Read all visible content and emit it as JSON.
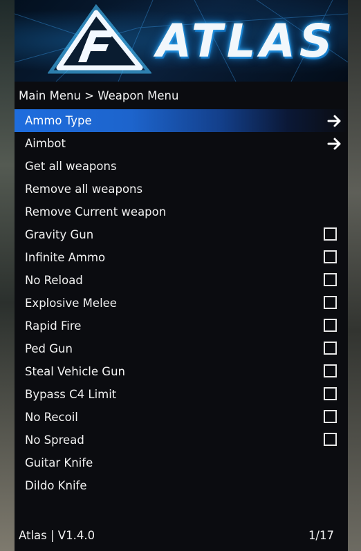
{
  "banner": {
    "logo_icon": "atlas-logo-icon",
    "brand": "ATLAS"
  },
  "breadcrumb": "Main Menu > Weapon Menu",
  "menu": {
    "items": [
      {
        "label": "Ammo Type",
        "control": "arrow",
        "selected": true
      },
      {
        "label": "Aimbot",
        "control": "arrow"
      },
      {
        "label": "Get all weapons",
        "control": "none"
      },
      {
        "label": "Remove all weapons",
        "control": "none"
      },
      {
        "label": "Remove Current weapon",
        "control": "none"
      },
      {
        "label": "Gravity Gun",
        "control": "checkbox",
        "checked": false
      },
      {
        "label": "Infinite Ammo",
        "control": "checkbox",
        "checked": false
      },
      {
        "label": "No Reload",
        "control": "checkbox",
        "checked": false
      },
      {
        "label": "Explosive Melee",
        "control": "checkbox",
        "checked": false
      },
      {
        "label": "Rapid Fire",
        "control": "checkbox",
        "checked": false
      },
      {
        "label": "Ped Gun",
        "control": "checkbox",
        "checked": false
      },
      {
        "label": "Steal Vehicle Gun",
        "control": "checkbox",
        "checked": false
      },
      {
        "label": "Bypass C4 Limit",
        "control": "checkbox",
        "checked": false
      },
      {
        "label": "No Recoil",
        "control": "checkbox",
        "checked": false
      },
      {
        "label": "No Spread",
        "control": "checkbox",
        "checked": false
      },
      {
        "label": "Guitar Knife",
        "control": "none"
      },
      {
        "label": "Dildo Knife",
        "control": "none"
      }
    ]
  },
  "footer": {
    "version": "Atlas | V1.4.0",
    "page": "1/17"
  },
  "colors": {
    "selected_highlight": "#1e6dde",
    "menu_bg": "#0b0c10",
    "text": "#f2f2f2"
  }
}
